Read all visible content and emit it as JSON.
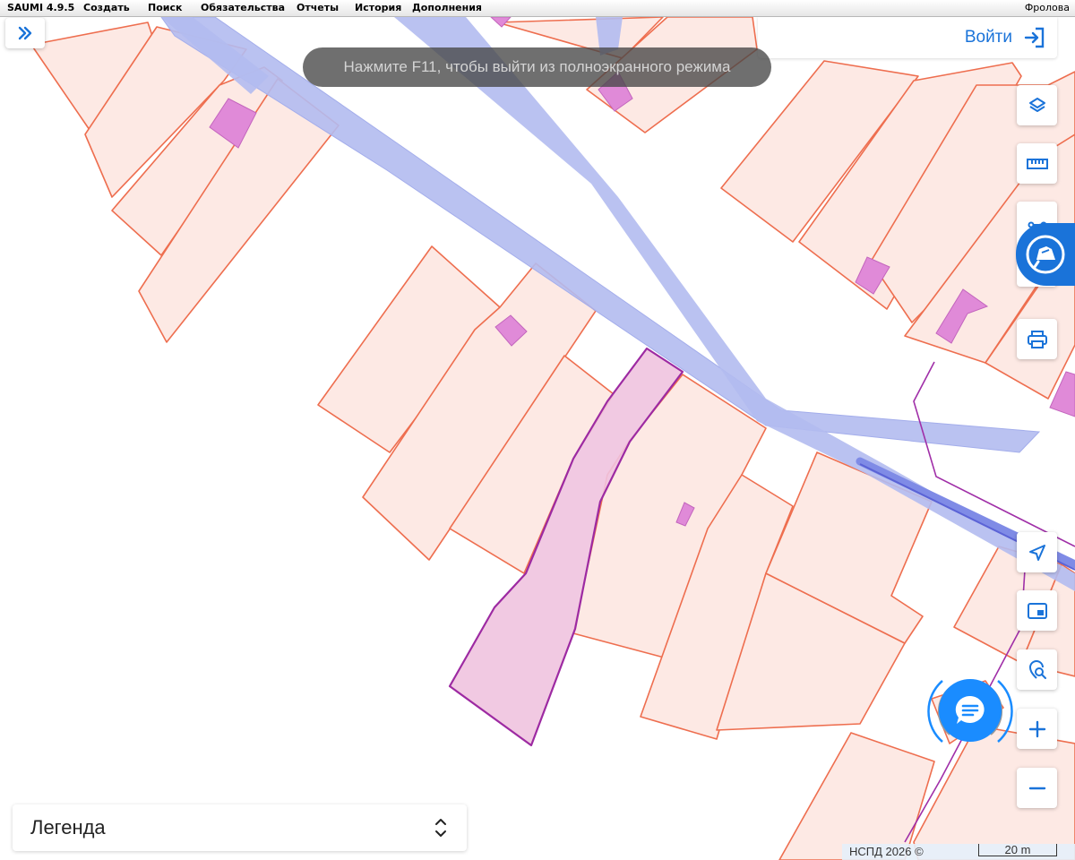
{
  "menubar": {
    "items": [
      "SAUMI 4.9.5",
      "Создать",
      "Поиск",
      "Обязательства",
      "Отчеты",
      "История",
      "Дополнения"
    ],
    "user": "Фролова"
  },
  "login": {
    "label": "Войти",
    "icon": "login-icon"
  },
  "toast": {
    "text": "Нажмите F11, чтобы выйти из полноэкранного режима"
  },
  "toolbar": {
    "expand_icon": "double-chevron-right-icon",
    "right_top": [
      "layers-icon",
      "ruler-icon",
      "measure-area-icon",
      "print-icon"
    ],
    "right_bottom": [
      "locate-icon",
      "minimap-icon",
      "search-location-icon",
      "zoom-in-icon",
      "zoom-out-icon"
    ]
  },
  "legend": {
    "title": "Легенда",
    "icon": "expand-collapse-icon"
  },
  "attribution": {
    "text": "НСПД 2026 ©",
    "scale": "20 m"
  },
  "colors": {
    "parcel_fill": "#fde9e4",
    "parcel_stroke": "#ee6e4f",
    "building_fill": "#e08ad8",
    "road_fill": "#b2bbf0",
    "selected_fill": "#efc3df",
    "selected_stroke": "#9d2aa2",
    "accent": "#1a73d9"
  }
}
